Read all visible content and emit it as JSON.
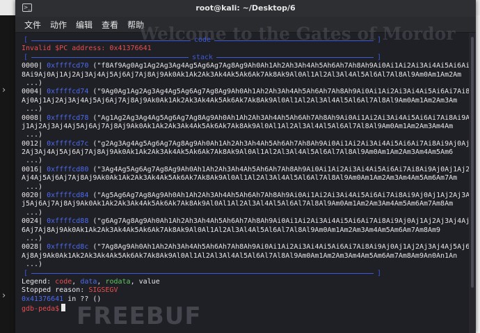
{
  "window": {
    "title": "root@kali: ~/Desktop/6"
  },
  "menu": [
    "文件",
    "动作",
    "编辑",
    "查看",
    "帮助"
  ],
  "background_page": {
    "heading": "Welcome to the Gates of Mordor",
    "watermark": "FREEBUF"
  },
  "gdb": {
    "code_section": "code",
    "invalid_pc": "Invalid $PC address: 0x41376641",
    "stack_section": "stack",
    "stack_rows": [
      {
        "idx": "0000",
        "addr": "0xffffcd70",
        "str": "(\"f8Af9Ag0Ag1Ag2Ag3Ag4Ag5Ag6Ag7Ag8Ag9Ah0Ah1Ah2Ah3Ah4Ah5Ah6Ah7Ah8Ah9Ai0Ai1Ai2Ai3Ai4Ai5Ai6Ai7Ai",
        "cont": "8Ai9Aj0Aj1Aj2Aj3Aj4Aj5Aj6Aj7Aj8Aj9Ak0Ak1Ak2Ak3Ak4Ak5Ak6Ak7Ak8Ak9Al0Al1Al2Al3Al4Al5Al6Al7Al8Al9Am0Am1Am2Am"
      },
      {
        "idx": "0004",
        "addr": "0xffffcd74",
        "str": "(\"9Ag0Ag1Ag2Ag3Ag4Ag5Ag6Ag7Ag8Ag9Ah0Ah1Ah2Ah3Ah4Ah5Ah6Ah7Ah8Ah9Ai0Ai1Ai2Ai3Ai4Ai5Ai6Ai7Ai8Ai9",
        "cont": "Aj0Aj1Aj2Aj3Aj4Aj5Aj6Aj7Aj8Aj9Ak0Ak1Ak2Ak3Ak4Ak5Ak6Ak7Ak8Ak9Al0Al1Al2Al3Al4Al5Al6Al7Al8Al9Am0Am1Am2Am3Am"
      },
      {
        "idx": "0008",
        "addr": "0xffffcd78",
        "str": "(\"Ag1Ag2Ag3Ag4Ag5Ag6Ag7Ag8Ag9Ah0Ah1Ah2Ah3Ah4Ah5Ah6Ah7Ah8Ah9Ai0Ai1Ai2Ai3Ai4Ai5Ai6Ai7Ai8Ai9Aj0A",
        "cont": "j1Aj2Aj3Aj4Aj5Aj6Aj7Aj8Aj9Ak0Ak1Ak2Ak3Ak4Ak5Ak6Ak7Ak8Ak9Al0Al1Al2Al3Al4Al5Al6Al7Al8Al9Am0Am1Am2Am3Am4Am"
      },
      {
        "idx": "0012",
        "addr": "0xffffcd7c",
        "str": "(\"g2Ag3Ag4Ag5Ag6Ag7Ag8Ag9Ah0Ah1Ah2Ah3Ah4Ah5Ah6Ah7Ah8Ah9Ai0Ai1Ai2Ai3Ai4Ai5Ai6Ai7Ai8Ai9Aj0Aj1A",
        "cont": "2Aj3Aj4Aj5Aj6Aj7Aj8Aj9Ak0Ak1Ak2Ak3Ak4Ak5Ak6Ak7Ak8Ak9Al0Al1Al2Al3Al4Al5Al6Al7Al8Al9Am0Am1Am2Am3Am4Am5Am6"
      },
      {
        "idx": "0016",
        "addr": "0xffffcd80",
        "str": "(\"3Ag4Ag5Ag6Ag7Ag8Ag9Ah0Ah1Ah2Ah3Ah4Ah5Ah6Ah7Ah8Ah9Ai0Ai1Ai2Ai3Ai4Ai5Ai6Ai7Ai8Ai9Aj0Aj1Aj2Aj3",
        "cont": "Aj4Aj5Aj6Aj7Aj8Aj9Ak0Ak1Ak2Ak3Ak4Ak5Ak6Ak7Ak8Ak9Al0Al1Al2Al3Al4Al5Al6Al7Al8Al9Am0Am1Am2Am3Am4Am5Am6Am7Am"
      },
      {
        "idx": "0020",
        "addr": "0xffffcd84",
        "str": "(\"Ag5Ag6Ag7Ag8Ag9Ah0Ah1Ah2Ah3Ah4Ah5Ah6Ah7Ah8Ah9Ai0Ai1Ai2Ai3Ai4Ai5Ai6Ai7Ai8Ai9Aj0Aj1Aj2Aj3Aj4A",
        "cont": "j5Aj6Aj7Aj8Aj9Ak0Ak1Ak2Ak3Ak4Ak5Ak6Ak7Ak8Ak9Al0Al1Al2Al3Al4Al5Al6Al7Al8Al9Am0Am1Am2Am3Am4Am5Am6Am7Am8Am"
      },
      {
        "idx": "0024",
        "addr": "0xffffcd88",
        "str": "(\"g6Ag7Ag8Ag9Ah0Ah1Ah2Ah3Ah4Ah5Ah6Ah7Ah8Ah9Ai0Ai1Ai2Ai3Ai4Ai5Ai6Ai7Ai8Ai9Aj0Aj1Aj2Aj3Aj4Aj5A",
        "cont": "6Aj7Aj8Aj9Ak0Ak1Ak2Ak3Ak4Ak5Ak6Ak7Ak8Ak9Al0Al1Al2Al3Al4Al5Al6Al7Al8Al9Am0Am1Am2Am3Am4Am5Am6Am7Am8Am9"
      },
      {
        "idx": "0028",
        "addr": "0xffffcd8c",
        "str": "(\"7Ag8Ag9Ah0Ah1Ah2Ah3Ah4Ah5Ah6Ah7Ah8Ah9Ai0Ai1Ai2Ai3Ai4Ai5Ai6Ai7Ai8Ai9Aj0Aj1Aj2Aj3Aj4Aj5Aj6A",
        "cont": "Aj8Aj9Ak0Ak1Ak2Ak3Ak4Ak5Ak6Ak7Ak8Ak9Al0Al1Al2Al3Al4Al5Al6Al7Al8Al9Am0Am1Am2Am3Am4Am5Am6Am7Am8Am9An0An1An"
      }
    ],
    "ellipsis": "...)",
    "legend_prefix": "Legend: ",
    "legend_code": "code",
    "legend_data": "data",
    "legend_rodata": "rodata",
    "legend_value": "value",
    "stopped_prefix": "Stopped reason: ",
    "stopped_reason": "SIGSEGV",
    "fault_addr": "0x41376641",
    "fault_rest": " in ?? ()",
    "prompt": "gdb-peda$"
  },
  "colors": {
    "red": "#e85050",
    "blue": "#4d6cf0",
    "green": "#5ec85e",
    "terminal_bg": "#1f1f26"
  }
}
